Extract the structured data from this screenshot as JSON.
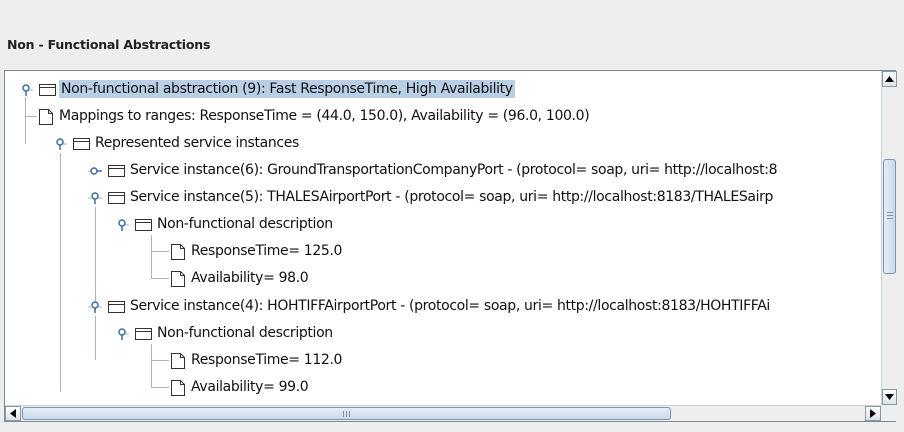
{
  "section": {
    "title": "Non - Functional Abstractions"
  },
  "tree": {
    "nodes": [
      {
        "label": "Non-functional abstraction (9): Fast ResponseTime, High Availability",
        "type": "folder",
        "state": "expanded",
        "selected": true
      },
      {
        "label": "Mappings to ranges: ResponseTime = (44.0, 150.0), Availability = (96.0, 100.0)",
        "type": "leaf"
      },
      {
        "label": "Represented service instances",
        "type": "folder",
        "state": "expanded"
      },
      {
        "label": "Service instance(6): GroundTransportationCompanyPort - (protocol= soap, uri= http://localhost:8",
        "type": "folder",
        "state": "collapsed"
      },
      {
        "label": "Service instance(5): THALESAirportPort - (protocol= soap, uri= http://localhost:8183/THALESairp",
        "type": "folder",
        "state": "expanded"
      },
      {
        "label": "Non-functional description",
        "type": "folder",
        "state": "expanded"
      },
      {
        "label": "ResponseTime= 125.0",
        "type": "leaf"
      },
      {
        "label": "Availability= 98.0",
        "type": "leaf"
      },
      {
        "label": "Service instance(4): HOHTIFFAirportPort - (protocol= soap, uri= http://localhost:8183/HOHTIFFAi",
        "type": "folder",
        "state": "expanded"
      },
      {
        "label": "Non-functional description",
        "type": "folder",
        "state": "expanded"
      },
      {
        "label": "ResponseTime= 112.0",
        "type": "leaf"
      },
      {
        "label": "Availability= 99.0",
        "type": "leaf"
      }
    ]
  },
  "scrollbars": {
    "vertical_position": 0.27,
    "horizontal_position": 0.0,
    "up_icon": "arrow-up-icon",
    "down_icon": "arrow-down-icon",
    "left_icon": "arrow-left-icon",
    "right_icon": "arrow-right-icon"
  },
  "colors": {
    "selection": "#b8cfe5",
    "guide_lines": "#a3b4c6",
    "border": "#7a8a99"
  }
}
